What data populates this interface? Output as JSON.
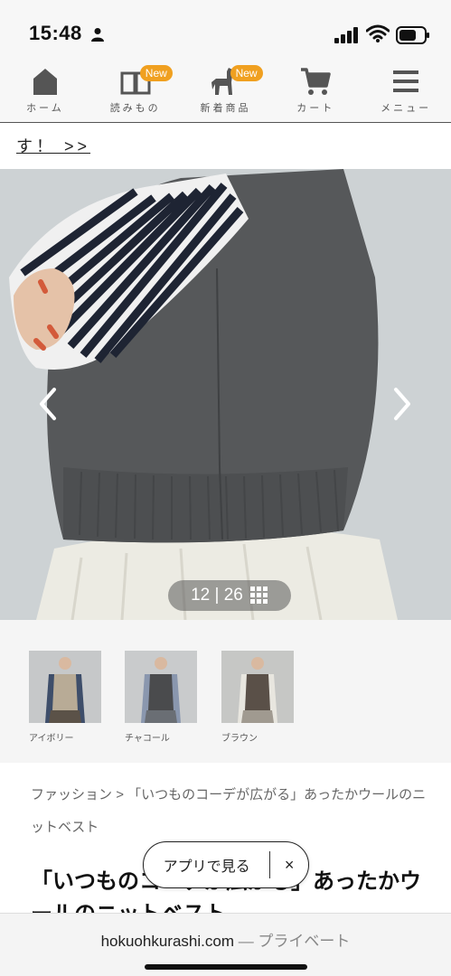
{
  "status_bar": {
    "time": "15:48"
  },
  "nav": {
    "items": [
      {
        "label": "ホーム",
        "icon": "home-icon"
      },
      {
        "label": "読みもの",
        "icon": "book-icon",
        "badge": "New"
      },
      {
        "label": "新着商品",
        "icon": "horse-icon",
        "badge": "New"
      },
      {
        "label": "カート",
        "icon": "cart-icon"
      },
      {
        "label": "メニュー",
        "icon": "menu-icon"
      }
    ]
  },
  "promo_link": "す！ >>",
  "hero": {
    "counter": "12 | 26"
  },
  "thumbnails": [
    {
      "label": "アイボリー",
      "vest_color": "#b8ab96"
    },
    {
      "label": "チャコール",
      "vest_color": "#4a4b4d"
    },
    {
      "label": "ブラウン",
      "vest_color": "#5a5048"
    }
  ],
  "breadcrumb": {
    "category": "ファッション",
    "separator": ">",
    "current": "「いつものコーデが広がる」あったかウールのニットベスト"
  },
  "product": {
    "title": "「いつものコーデが広がる」あったかウールのニットベスト"
  },
  "app_prompt": {
    "label": "アプリで見る",
    "close": "×"
  },
  "footer": {
    "domain": "hokuohkurashi.com",
    "suffix": " — プライベート"
  },
  "colors": {
    "accent": "#f0a020",
    "nav_icon": "#555555"
  }
}
